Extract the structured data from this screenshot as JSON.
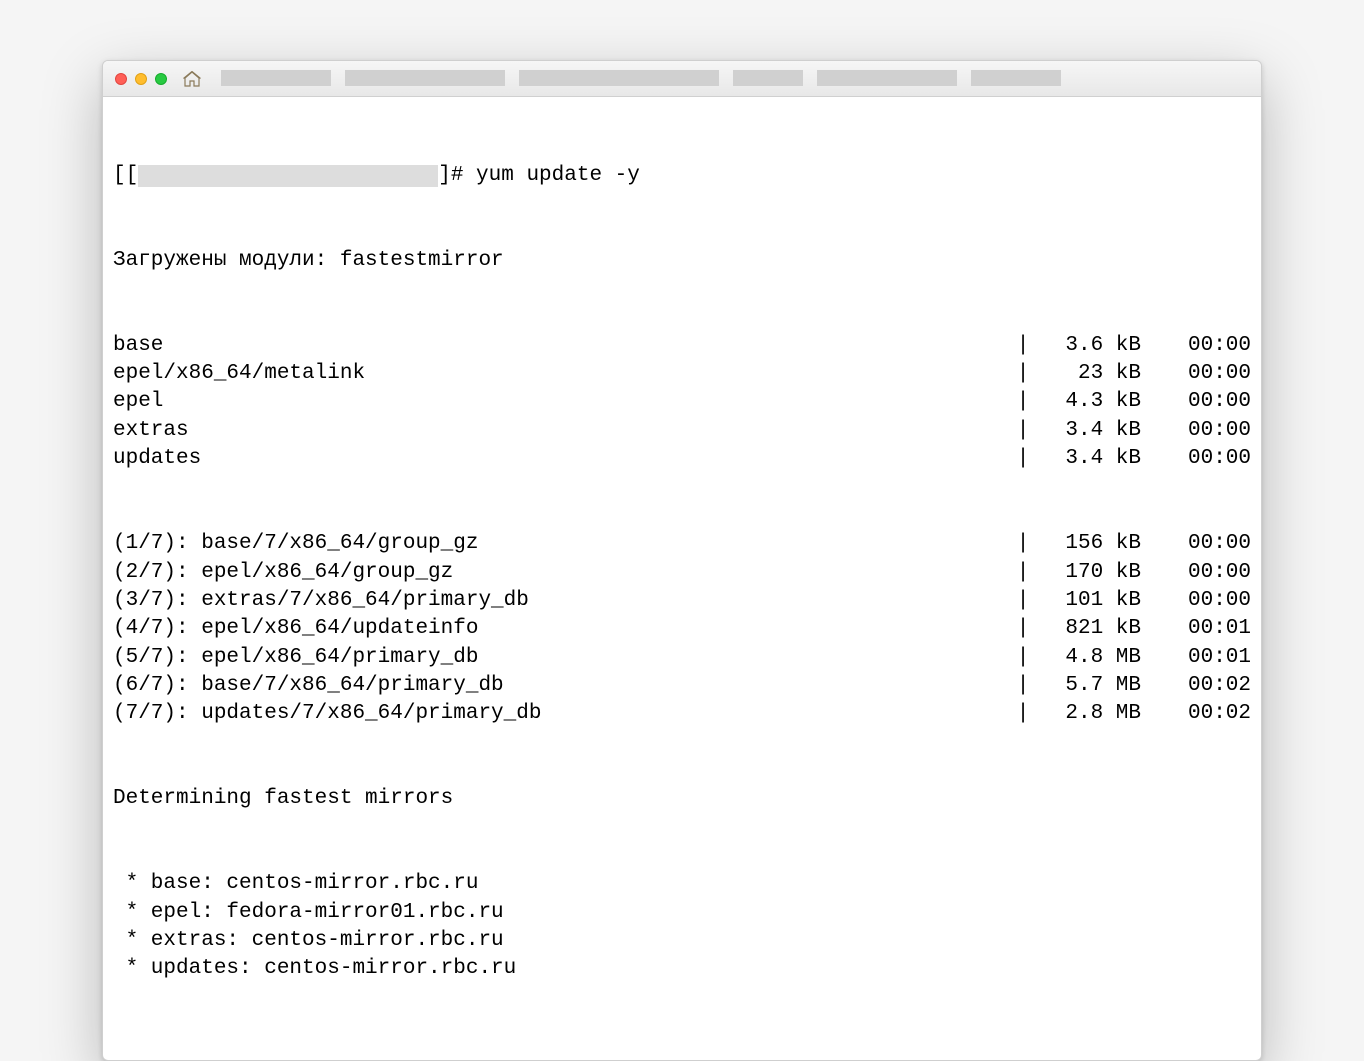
{
  "prompt": {
    "open": "[[",
    "close": "]# ",
    "command": "yum update -y"
  },
  "loaded_line": "Загружены модули: fastestmirror",
  "repos": [
    {
      "name": "base",
      "size": "3.6 kB",
      "time": "00:00"
    },
    {
      "name": "epel/x86_64/metalink",
      "size": " 23 kB",
      "time": "00:00"
    },
    {
      "name": "epel",
      "size": "4.3 kB",
      "time": "00:00"
    },
    {
      "name": "extras",
      "size": "3.4 kB",
      "time": "00:00"
    },
    {
      "name": "updates",
      "size": "3.4 kB",
      "time": "00:00"
    }
  ],
  "downloads": [
    {
      "name": "(1/7): base/7/x86_64/group_gz",
      "size": "156 kB",
      "time": "00:00"
    },
    {
      "name": "(2/7): epel/x86_64/group_gz",
      "size": "170 kB",
      "time": "00:00"
    },
    {
      "name": "(3/7): extras/7/x86_64/primary_db",
      "size": "101 kB",
      "time": "00:00"
    },
    {
      "name": "(4/7): epel/x86_64/updateinfo",
      "size": "821 kB",
      "time": "00:01"
    },
    {
      "name": "(5/7): epel/x86_64/primary_db",
      "size": "4.8 MB",
      "time": "00:01"
    },
    {
      "name": "(6/7): base/7/x86_64/primary_db",
      "size": "5.7 MB",
      "time": "00:02"
    },
    {
      "name": "(7/7): updates/7/x86_64/primary_db",
      "size": "2.8 MB",
      "time": "00:02"
    }
  ],
  "determining": "Determining fastest mirrors",
  "mirrors": [
    " * base: centos-mirror.rbc.ru",
    " * epel: fedora-mirror01.rbc.ru",
    " * extras: centos-mirror.rbc.ru",
    " * updates: centos-mirror.rbc.ru"
  ]
}
